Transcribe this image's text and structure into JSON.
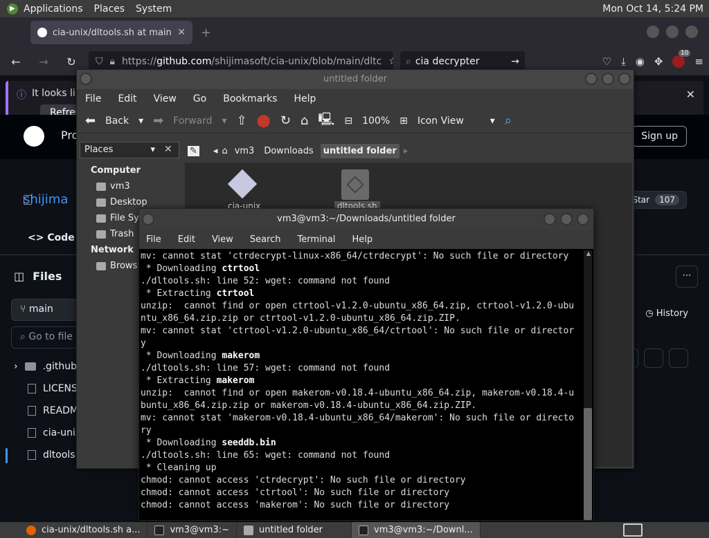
{
  "top_panel": {
    "menus": [
      "Applications",
      "Places",
      "System"
    ],
    "clock": "Mon Oct 14,  5:24 PM"
  },
  "browser": {
    "tab_title": "cia-unix/dltools.sh at main",
    "url_prefix": "https://",
    "url_host": "github.com",
    "url_path": "/shijimasoft/cia-unix/blob/main/dltc",
    "search_text": "cia decrypter",
    "ext_badge": "10",
    "notice_text": "It looks like",
    "notice_button": "Refresh"
  },
  "github": {
    "header_text": "Pro",
    "signup": "Sign up",
    "repo_owner": "shijima",
    "star_label": "Star",
    "star_count": "107",
    "code_tab": "Code",
    "files_title": "Files",
    "branch": "main",
    "go_to_file": "Go to file",
    "history": "History",
    "tree": [
      ".github",
      "LICENS",
      "READM",
      "cia-unix",
      "dltools.s"
    ]
  },
  "file_manager": {
    "title": "untitled folder",
    "menu": [
      "File",
      "Edit",
      "View",
      "Go",
      "Bookmarks",
      "Help"
    ],
    "back": "Back",
    "forward": "Forward",
    "zoom": "100%",
    "view_mode": "Icon View",
    "places_label": "Places",
    "sidebar": {
      "computer_heading": "Computer",
      "computer_items": [
        "vm3",
        "Desktop",
        "File Sy",
        "Trash"
      ],
      "network_heading": "Network",
      "network_items": [
        "Brows"
      ]
    },
    "path": [
      "vm3",
      "Downloads",
      "untitled folder"
    ],
    "files": [
      "cia-unix",
      "dltools.sh"
    ]
  },
  "terminal": {
    "title": "vm3@vm3:~/Downloads/untitled folder",
    "menu": [
      "File",
      "Edit",
      "View",
      "Search",
      "Terminal",
      "Help"
    ],
    "lines": [
      {
        "pre": "mv: cannot stat 'ctrdecrypt-linux-x86_64/ctrdecrypt': No such file or directory",
        "bold": "",
        "post": ""
      },
      {
        "pre": " * Downloading ",
        "bold": "ctrtool",
        "post": ""
      },
      {
        "pre": "./dltools.sh: line 52: wget: command not found",
        "bold": "",
        "post": ""
      },
      {
        "pre": " * Extracting ",
        "bold": "ctrtool",
        "post": ""
      },
      {
        "pre": "unzip:  cannot find or open ctrtool-v1.2.0-ubuntu_x86_64.zip, ctrtool-v1.2.0-ubu",
        "bold": "",
        "post": ""
      },
      {
        "pre": "ntu_x86_64.zip.zip or ctrtool-v1.2.0-ubuntu_x86_64.zip.ZIP.",
        "bold": "",
        "post": ""
      },
      {
        "pre": "mv: cannot stat 'ctrtool-v1.2.0-ubuntu_x86_64/ctrtool': No such file or director",
        "bold": "",
        "post": ""
      },
      {
        "pre": "y",
        "bold": "",
        "post": ""
      },
      {
        "pre": " * Downloading ",
        "bold": "makerom",
        "post": ""
      },
      {
        "pre": "./dltools.sh: line 57: wget: command not found",
        "bold": "",
        "post": ""
      },
      {
        "pre": " * Extracting ",
        "bold": "makerom",
        "post": ""
      },
      {
        "pre": "unzip:  cannot find or open makerom-v0.18.4-ubuntu_x86_64.zip, makerom-v0.18.4-u",
        "bold": "",
        "post": ""
      },
      {
        "pre": "buntu_x86_64.zip.zip or makerom-v0.18.4-ubuntu_x86_64.zip.ZIP.",
        "bold": "",
        "post": ""
      },
      {
        "pre": "mv: cannot stat 'makerom-v0.18.4-ubuntu_x86_64/makerom': No such file or directo",
        "bold": "",
        "post": ""
      },
      {
        "pre": "ry",
        "bold": "",
        "post": ""
      },
      {
        "pre": " * Downloading ",
        "bold": "seeddb.bin",
        "post": ""
      },
      {
        "pre": "./dltools.sh: line 65: wget: command not found",
        "bold": "",
        "post": ""
      },
      {
        "pre": " * Cleaning up",
        "bold": "",
        "post": ""
      },
      {
        "pre": "chmod: cannot access 'ctrdecrypt': No such file or directory",
        "bold": "",
        "post": ""
      },
      {
        "pre": "chmod: cannot access 'ctrtool': No such file or directory",
        "bold": "",
        "post": ""
      },
      {
        "pre": "chmod: cannot access 'makerom': No such file or directory",
        "bold": "",
        "post": ""
      }
    ]
  },
  "taskbar": {
    "tasks": [
      "cia-unix/dltools.sh a...",
      "vm3@vm3:~",
      "untitled folder",
      "vm3@vm3:~/Downl..."
    ]
  }
}
